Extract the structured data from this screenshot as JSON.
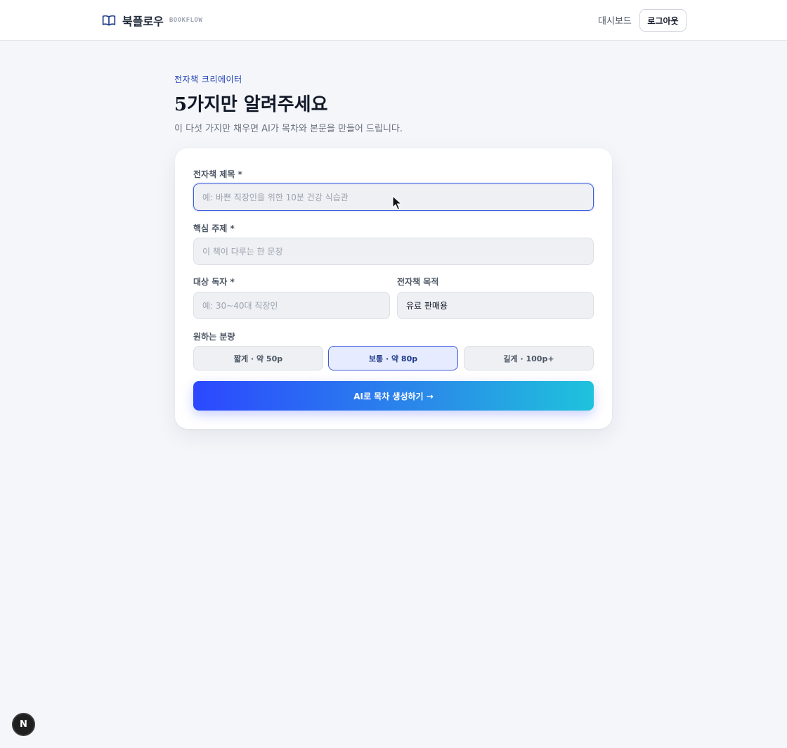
{
  "header": {
    "brand_name": "북플로우",
    "brand_sub": "BOOKFLOW",
    "nav_dashboard": "대시보드",
    "logout_label": "로그아웃",
    "brand_icon": "book-open-icon"
  },
  "page": {
    "eyebrow": "전자책 크리에이터",
    "title": "5가지만 알려주세요",
    "subtitle": "이 다섯 가지만 채우면 AI가 목차와 본문을 만들어 드립니다."
  },
  "form": {
    "title_label": "전자책 제목 *",
    "title_placeholder": "예: 바쁜 직장인을 위한 10분 건강 식습관",
    "topic_label": "핵심 주제 *",
    "topic_placeholder": "이 책이 다루는 한 문장",
    "audience_label": "대상 독자 *",
    "audience_placeholder": "예: 30~40대 직장인",
    "purpose_label": "전자책 목적",
    "purpose_value": "유료 판매용",
    "length_label": "원하는 분량",
    "length_options": [
      "짧게 · 약 50p",
      "보통 · 약 80p",
      "길게 · 100p+"
    ],
    "length_selected": "보통 · 약 80p",
    "submit_label": "AI로 목차 생성하기 →"
  },
  "dev_badge": "N",
  "colors": {
    "accent": "#3b5bdb",
    "gradient_start": "#2b48ff",
    "gradient_end": "#1ec3dc",
    "background": "#f5f6fa"
  }
}
